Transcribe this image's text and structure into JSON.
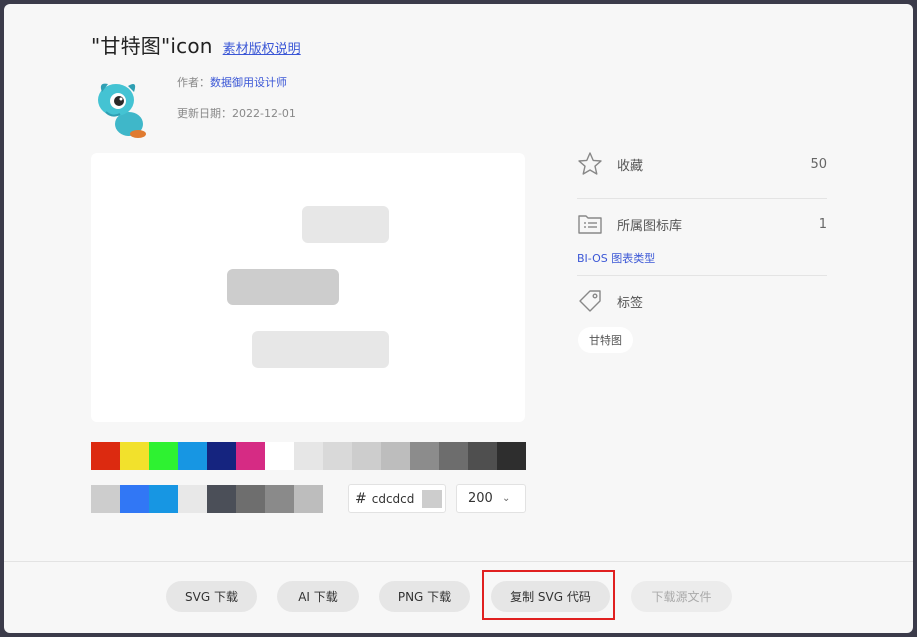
{
  "header": {
    "title": "\"甘特图\"icon",
    "copyright_link": "素材版权说明"
  },
  "meta": {
    "author_label": "作者：",
    "author_name": "数据御用设计师",
    "date_label": "更新日期：",
    "date_value": "2022-12-01"
  },
  "preview": {
    "bar_colors": [
      "#e7e7e7",
      "#cdcdcd",
      "#e7e7e7"
    ]
  },
  "palette": {
    "row1": [
      "#dc2a10",
      "#f2e12c",
      "#2ef231",
      "#1796e3",
      "#15247f",
      "#d62b84",
      "#ffffff",
      "#e6e6e6",
      "#d9d9d9",
      "#cdcdcd",
      "#bdbdbd",
      "#8c8c8c",
      "#6d6d6d",
      "#4f4f4f",
      "#2e2e2e"
    ],
    "row2": [
      "#cdcdcd",
      "#3177f5",
      "#1796e3",
      "#e8e8e8",
      "#4b4f58",
      "#6e6e6e",
      "#8a8a8a",
      "#bdbdbd"
    ]
  },
  "color_input": {
    "hash": "#",
    "value": "cdcdcd",
    "preview_color": "#cdcdcd"
  },
  "size_select": {
    "value": "200"
  },
  "sidebar": {
    "favorite_label": "收藏",
    "favorite_count": "50",
    "library_label": "所属图标库",
    "library_count": "1",
    "library_link": "BI-OS 图表类型",
    "tags_label": "标签",
    "tag": "甘特图"
  },
  "footer": {
    "svg_download": "SVG 下载",
    "ai_download": "AI 下载",
    "png_download": "PNG 下载",
    "copy_svg": "复制 SVG 代码",
    "download_source": "下载源文件"
  }
}
